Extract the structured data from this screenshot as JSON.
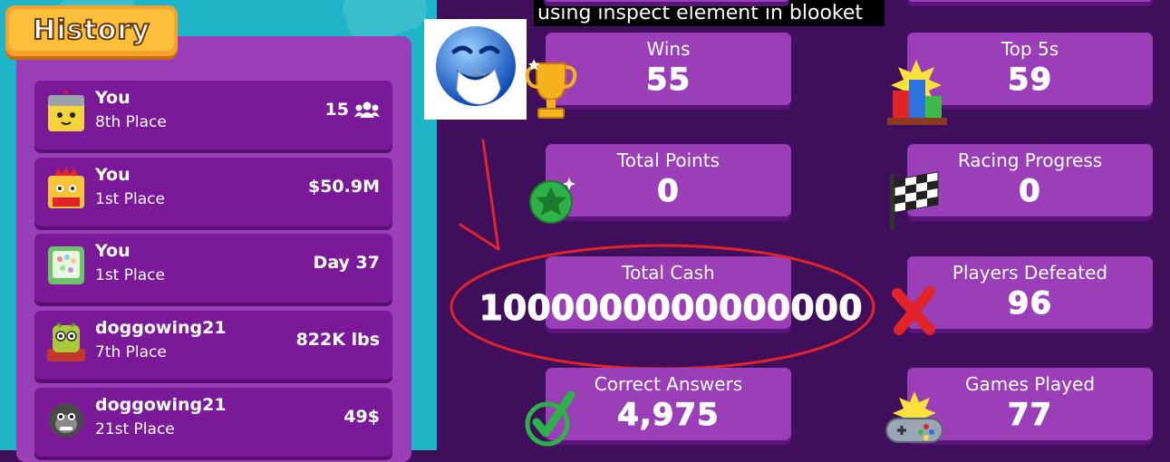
{
  "caption": "using inspect element in blooket",
  "history": {
    "title": "History",
    "items": [
      {
        "name": "You",
        "place": "8th Place",
        "value": "15",
        "icon": "players-icon",
        "avatar_color": "#f5d33a"
      },
      {
        "name": "You",
        "place": "1st Place",
        "value": "$50.9M",
        "icon": "",
        "avatar_color": "#f5c43a"
      },
      {
        "name": "You",
        "place": "1st Place",
        "value": "Day 37",
        "icon": "",
        "avatar_color": "#6cc36a"
      },
      {
        "name": "doggowing21",
        "place": "7th Place",
        "value": "822K lbs",
        "icon": "",
        "avatar_color": "#a8c93a"
      },
      {
        "name": "doggowing21",
        "place": "21st Place",
        "value": "49$",
        "icon": "",
        "avatar_color": "#4a4a4a"
      }
    ]
  },
  "stats": [
    {
      "label": "Wins",
      "value": "55",
      "icon": "trophy-icon"
    },
    {
      "label": "Top 5s",
      "value": "59",
      "icon": "podium-icon"
    },
    {
      "label": "Total Points",
      "value": "0",
      "icon": "star-gem-icon"
    },
    {
      "label": "Racing Progress",
      "value": "0",
      "icon": "checkered-flag-icon"
    },
    {
      "label": "Total Cash",
      "value": "1000000000000000",
      "icon": ""
    },
    {
      "label": "Players Defeated",
      "value": "96",
      "icon": "x-mark-icon"
    },
    {
      "label": "Correct Answers",
      "value": "4,975",
      "icon": "check-mark-icon"
    },
    {
      "label": "Games Played",
      "value": "77",
      "icon": "gamepad-icon"
    }
  ],
  "colors": {
    "accent_red": "#e0242a",
    "panel_purple": "#9b3fb8",
    "item_purple": "#7a1a98",
    "teal": "#1fb5c8"
  }
}
